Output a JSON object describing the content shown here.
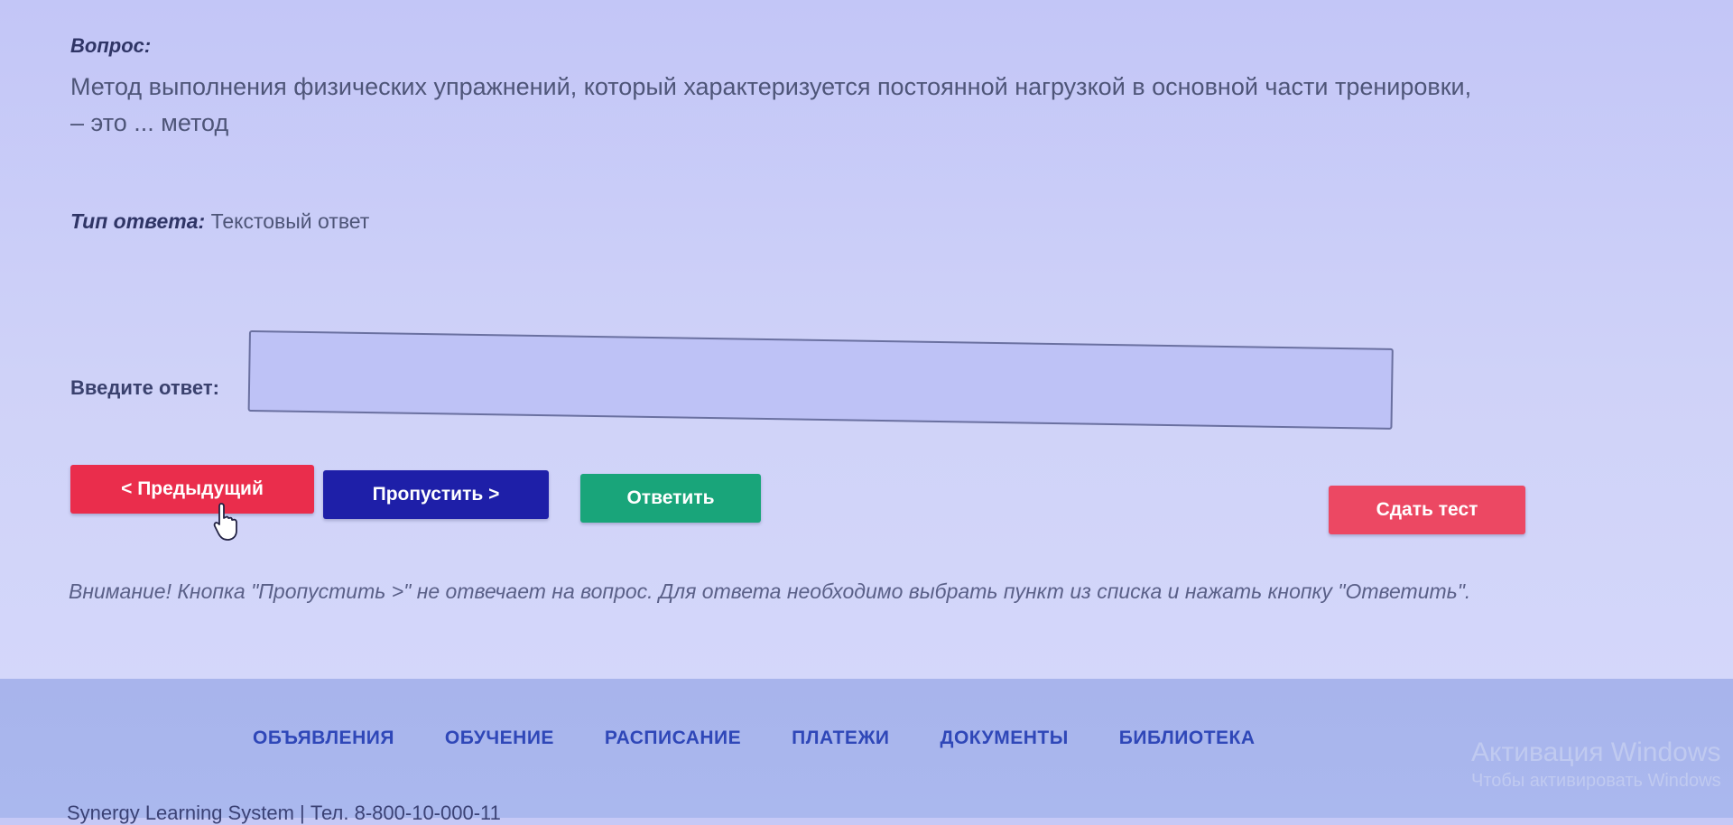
{
  "question": {
    "label": "Вопрос:",
    "text": "Метод выполнения физических упражнений, который характеризуется постоянной нагрузкой в основной части тренировки, – это ... метод"
  },
  "answer_type": {
    "label": "Тип ответа:",
    "value": "Текстовый ответ"
  },
  "answer_input": {
    "label": "Введите ответ:",
    "value": ""
  },
  "buttons": {
    "prev": "< Предыдущий",
    "skip": "Пропустить >",
    "answer": "Ответить",
    "submit": "Сдать тест"
  },
  "warning": "Внимание! Кнопка \"Пропустить >\" не отвечает на вопрос. Для ответа необходимо выбрать пункт из списка и нажать кнопку \"Ответить\".",
  "footer": {
    "nav": [
      "ОБЪЯВЛЕНИЯ",
      "ОБУЧЕНИЕ",
      "РАСПИСАНИЕ",
      "ПЛАТЕЖИ",
      "ДОКУМЕНТЫ",
      "БИБЛИОТЕКА"
    ],
    "bottom_text": "Synergy Learning System | Тел. 8-800-10-000-11",
    "watermark_title": "Активация Windows",
    "watermark_sub": "Чтобы активировать Windows"
  },
  "colors": {
    "prev": "#ea2d4c",
    "skip": "#1e1fa8",
    "answer": "#19a57a",
    "submit": "#ec4863",
    "nav_link": "#2f47b8"
  },
  "icons": {
    "cursor": "hand-pointer-icon"
  }
}
